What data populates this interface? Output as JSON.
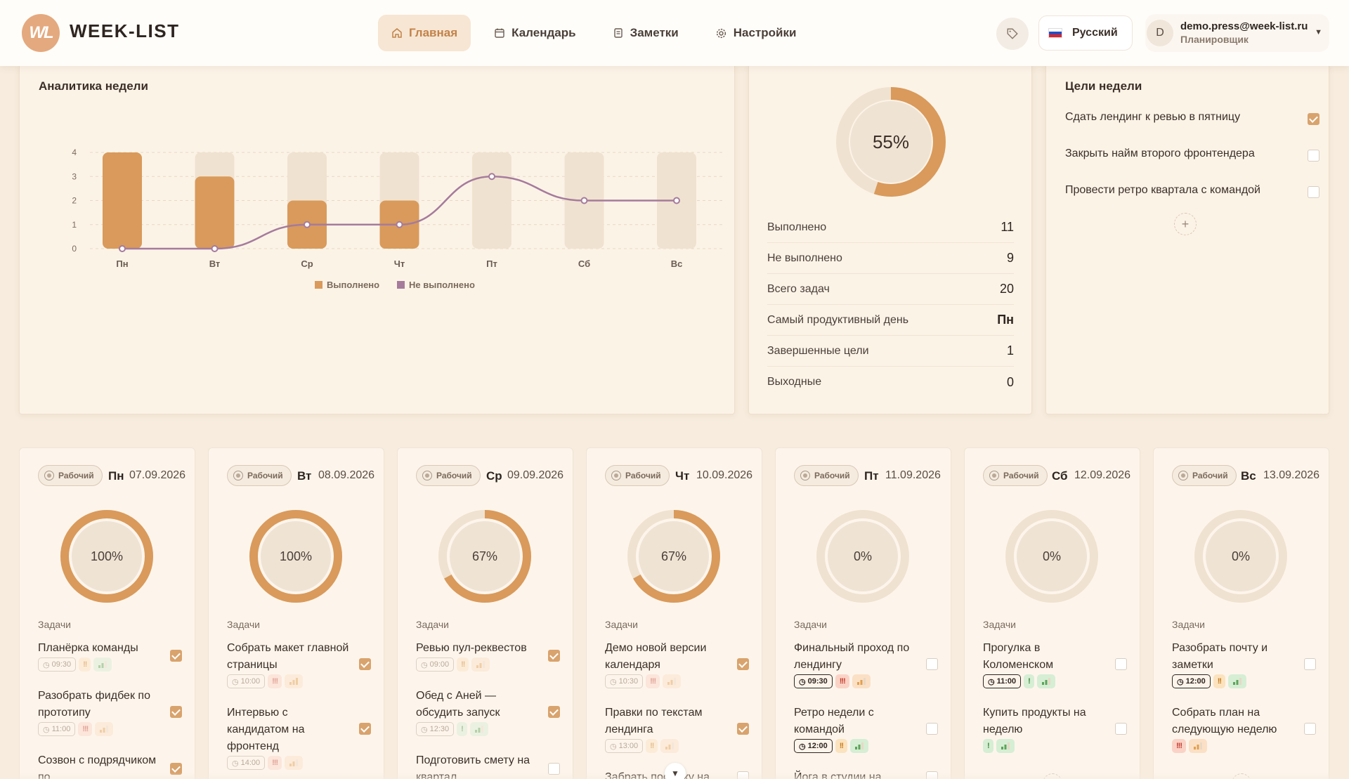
{
  "app": {
    "logo_mark": "WL",
    "name": "WEEK-LIST"
  },
  "nav": [
    {
      "label": "Главная",
      "icon": "home-icon",
      "active": true
    },
    {
      "label": "Календарь",
      "icon": "calendar-icon",
      "active": false
    },
    {
      "label": "Заметки",
      "icon": "notes-icon",
      "active": false
    },
    {
      "label": "Настройки",
      "icon": "gear-icon",
      "active": false
    }
  ],
  "language": {
    "label": "Русский",
    "flag": "ru-flag-icon"
  },
  "user": {
    "initial": "D",
    "email": "demo.press@week-list.ru",
    "role": "Планировщик"
  },
  "analytics": {
    "title": "Аналитика недели"
  },
  "chart_data": {
    "type": "bar",
    "categories": [
      "Пн",
      "Вт",
      "Ср",
      "Чт",
      "Пт",
      "Сб",
      "Вс"
    ],
    "series": [
      {
        "name": "Выполнено",
        "type": "bar",
        "values": [
          4,
          3,
          2,
          2,
          0,
          0,
          0
        ],
        "color": "#d99a5b"
      },
      {
        "name": "Не выполнено",
        "type": "line",
        "values": [
          0,
          0,
          1,
          1,
          3,
          2,
          2
        ],
        "color": "#a57b9c"
      }
    ],
    "ylim": [
      0,
      4
    ],
    "yticks": [
      0,
      1,
      2,
      3,
      4
    ],
    "grid": true,
    "legend": "bottom"
  },
  "summary": {
    "percent": "55%",
    "percent_value": 55,
    "rows": [
      {
        "label": "Выполнено",
        "value": "11"
      },
      {
        "label": "Не выполнено",
        "value": "9"
      },
      {
        "label": "Всего задач",
        "value": "20"
      },
      {
        "label": "Самый продуктивный день",
        "value": "Пн"
      },
      {
        "label": "Завершенные цели",
        "value": "1"
      },
      {
        "label": "Выходные",
        "value": "0"
      }
    ]
  },
  "goals": {
    "title": "Цели недели",
    "items": [
      {
        "text": "Сдать лендинг к ревью в пятницу",
        "done": true
      },
      {
        "text": "Закрыть найм второго фронтендера",
        "done": false
      },
      {
        "text": "Провести ретро квартала с командой",
        "done": false
      }
    ],
    "add_label": "+"
  },
  "tasks_label": "Задачи",
  "days": [
    {
      "badge": "Рабочий",
      "name": "Пн",
      "date": "07.09.2026",
      "percent": "100%",
      "progress": 100,
      "tasks": [
        {
          "title": "Планёрка команды",
          "time": "09:30",
          "priority": "!!",
          "level": "low",
          "done": true
        },
        {
          "title": "Разобрать фидбек по прототипу",
          "time": "11:00",
          "priority": "!!!",
          "level": "mid",
          "done": true
        },
        {
          "title": "Созвон с подрядчиком по",
          "time": "",
          "priority": "",
          "level": "",
          "done": true
        }
      ]
    },
    {
      "badge": "Рабочий",
      "name": "Вт",
      "date": "08.09.2026",
      "percent": "100%",
      "progress": 100,
      "tasks": [
        {
          "title": "Собрать макет главной страницы",
          "time": "10:00",
          "priority": "!!!",
          "level": "high",
          "done": true
        },
        {
          "title": "Интервью с кандидатом на фронтенд",
          "time": "14:00",
          "priority": "!!!",
          "level": "mid",
          "done": true
        }
      ]
    },
    {
      "badge": "Рабочий",
      "name": "Ср",
      "date": "09.09.2026",
      "percent": "67%",
      "progress": 67,
      "tasks": [
        {
          "title": "Ревью пул-реквестов",
          "time": "09:00",
          "priority": "!!",
          "level": "mid",
          "done": true
        },
        {
          "title": "Обед с Аней — обсудить запуск",
          "time": "12:30",
          "priority": "!",
          "level": "low",
          "done": true
        },
        {
          "title": "Подготовить смету на квартал",
          "time": "",
          "priority": "",
          "level": "",
          "done": false
        }
      ]
    },
    {
      "badge": "Рабочий",
      "name": "Чт",
      "date": "10.09.2026",
      "percent": "67%",
      "progress": 67,
      "tasks": [
        {
          "title": "Демо новой версии календаря",
          "time": "10:30",
          "priority": "!!!",
          "level": "mid",
          "done": true
        },
        {
          "title": "Правки по текстам лендинга",
          "time": "13:00",
          "priority": "!!",
          "level": "mid",
          "done": true
        },
        {
          "title": "Забрать посылку на",
          "time": "",
          "priority": "",
          "level": "",
          "done": false
        }
      ]
    },
    {
      "badge": "Рабочий",
      "name": "Пт",
      "date": "11.09.2026",
      "percent": "0%",
      "progress": 0,
      "tasks": [
        {
          "title": "Финальный проход по лендингу",
          "time": "09:30",
          "priority": "!!!",
          "level": "mid",
          "done": false
        },
        {
          "title": "Ретро недели с командой",
          "time": "12:00",
          "priority": "!!",
          "level": "low",
          "done": false
        },
        {
          "title": "Йога в студии на",
          "time": "",
          "priority": "",
          "level": "",
          "done": false
        }
      ]
    },
    {
      "badge": "Рабочий",
      "name": "Сб",
      "date": "12.09.2026",
      "percent": "0%",
      "progress": 0,
      "tasks": [
        {
          "title": "Прогулка в Коломенском",
          "time": "11:00",
          "priority": "!",
          "level": "low",
          "done": false
        },
        {
          "title": "Купить продукты на неделю",
          "time": "",
          "priority": "!",
          "level": "low",
          "done": false
        }
      ]
    },
    {
      "badge": "Рабочий",
      "name": "Вс",
      "date": "13.09.2026",
      "percent": "0%",
      "progress": 0,
      "tasks": [
        {
          "title": "Разобрать почту и заметки",
          "time": "12:00",
          "priority": "!!",
          "level": "low",
          "done": false
        },
        {
          "title": "Собрать план на следующую неделю",
          "time": "",
          "priority": "!!!",
          "level": "mid",
          "done": false
        }
      ]
    }
  ]
}
